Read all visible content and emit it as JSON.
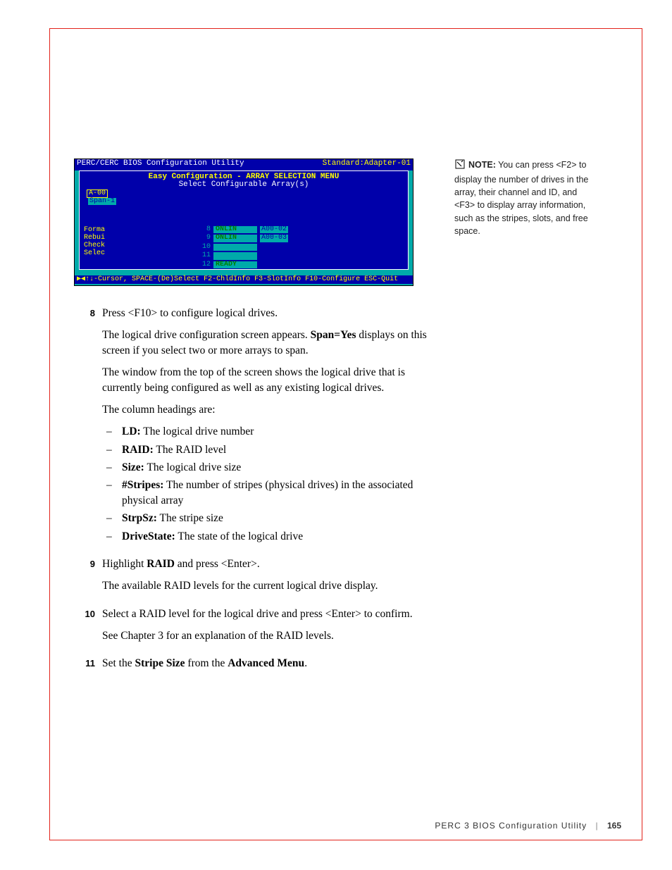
{
  "screenshot": {
    "titleLeft": "PERC/CERC BIOS Configuration Utility",
    "titleRight": "Standard:Adapter-01",
    "menuTitle": "Easy Configuration - ARRAY SELECTION MENU",
    "menuSub": "Select Configurable Array(s)",
    "a00": "A-00",
    "span": "Span-1",
    "leftMenu": [
      "Forma",
      "Rebui",
      "Check",
      "Selec"
    ],
    "rows": [
      {
        "n": "8",
        "status": "ONLIN",
        "tag": "A00-02"
      },
      {
        "n": "9",
        "status": "ONLIN",
        "tag": "A00-03"
      },
      {
        "n": "10",
        "status": "",
        "tag": ""
      },
      {
        "n": "11",
        "status": "",
        "tag": ""
      },
      {
        "n": "12",
        "status": "READY",
        "tag": ""
      }
    ],
    "hint": "▶◀↑↓-Cursor, SPACE-(De)Select F2-ChldInfo F3-SlotInfo F10-Configure ESC-Quit"
  },
  "note": {
    "label": "NOTE:",
    "text": " You can press <F2> to display the number of drives in the array, their channel and ID, and <F3> to display array information, such as the stripes, slots, and free space."
  },
  "steps": {
    "s8": {
      "num": "8",
      "p1a": "Press <F10> to configure logical drives.",
      "p2a": "The logical drive configuration screen appears. ",
      "p2b": "Span=Yes",
      "p2c": " displays on this screen if you select two or more arrays to span.",
      "p3": "The window from the top of the screen shows the logical drive that is currently being configured as well as any existing logical drives.",
      "p4": "The column headings are:",
      "items": [
        {
          "b": "LD:",
          "t": "  The logical drive number"
        },
        {
          "b": "RAID:",
          "t": "  The RAID level"
        },
        {
          "b": "Size:",
          "t": "  The logical drive size"
        },
        {
          "b": "#Stripes:",
          "t": "  The number of stripes (physical drives) in the associated physical array"
        },
        {
          "b": "StrpSz:",
          "t": "  The stripe size"
        },
        {
          "b": "DriveState:",
          "t": " The state of the logical drive"
        }
      ]
    },
    "s9": {
      "num": "9",
      "p1a": "Highlight ",
      "p1b": "RAID",
      "p1c": " and press <Enter>.",
      "p2": "The available RAID levels for the current logical drive display."
    },
    "s10": {
      "num": "10",
      "p1": "Select a RAID level for the logical drive and press <Enter> to confirm.",
      "p2": "See Chapter 3 for an explanation of the RAID levels."
    },
    "s11": {
      "num": "11",
      "p1a": "Set the ",
      "p1b": "Stripe Size",
      "p1c": " from the ",
      "p1d": "Advanced Menu",
      "p1e": "."
    }
  },
  "footer": {
    "title": "PERC 3 BIOS Configuration Utility",
    "page": "165"
  }
}
